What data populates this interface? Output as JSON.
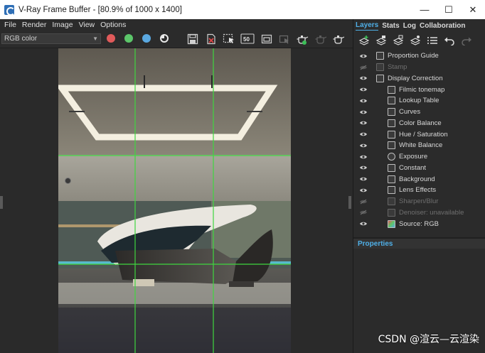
{
  "window": {
    "title": "V-Ray Frame Buffer - [80.9% of 1000 x 1400]",
    "controls": [
      "—",
      "☐",
      "✕"
    ]
  },
  "menu": [
    "File",
    "Render",
    "Image",
    "View",
    "Options"
  ],
  "toolbar": {
    "channel": "RGB color",
    "channel_dots": [
      {
        "name": "red-channel-toggle",
        "color": "#e05a5a"
      },
      {
        "name": "green-channel-toggle",
        "color": "#5cc66a"
      },
      {
        "name": "blue-channel-toggle",
        "color": "#5aa8e0"
      },
      {
        "name": "alpha-channel-toggle",
        "color": "#dddddd"
      }
    ],
    "icons": [
      "save-image-icon",
      "clear-image-icon",
      "region-render-icon",
      "history-50-icon",
      "compare-icon",
      "cursor-track-icon",
      "render-teapot-icon",
      "stop-render-icon",
      "interactive-render-icon"
    ],
    "history_label": "50"
  },
  "panel": {
    "tabs": [
      "Layers",
      "Stats",
      "Log",
      "Collaboration"
    ],
    "active_tab": "Layers",
    "layer_tools": [
      "add-layer-icon",
      "save-layers-icon",
      "load-layers-icon",
      "layer-presets-icon",
      "list-icon",
      "undo-icon",
      "redo-icon"
    ],
    "layers": [
      {
        "label": "Proportion Guide",
        "indent": 0,
        "enabled": true,
        "icon": "proportion-guide-icon"
      },
      {
        "label": "Stamp",
        "indent": 0,
        "enabled": false,
        "icon": "stamp-icon"
      },
      {
        "label": "Display Correction",
        "indent": 0,
        "enabled": true,
        "icon": "display-correction-icon"
      },
      {
        "label": "Filmic tonemap",
        "indent": 1,
        "enabled": true,
        "icon": "filmic-tonemap-icon"
      },
      {
        "label": "Lookup Table",
        "indent": 1,
        "enabled": true,
        "icon": "lut-icon"
      },
      {
        "label": "Curves",
        "indent": 1,
        "enabled": true,
        "icon": "curves-icon"
      },
      {
        "label": "Color Balance",
        "indent": 1,
        "enabled": true,
        "icon": "color-balance-icon"
      },
      {
        "label": "Hue / Saturation",
        "indent": 1,
        "enabled": true,
        "icon": "hue-saturation-icon"
      },
      {
        "label": "White Balance",
        "indent": 1,
        "enabled": true,
        "icon": "white-balance-icon"
      },
      {
        "label": "Exposure",
        "indent": 1,
        "enabled": true,
        "icon": "exposure-icon"
      },
      {
        "label": "Constant",
        "indent": 1,
        "enabled": true,
        "icon": "constant-icon"
      },
      {
        "label": "Background",
        "indent": 1,
        "enabled": true,
        "icon": "background-icon"
      },
      {
        "label": "Lens Effects",
        "indent": 1,
        "enabled": true,
        "icon": "lens-effects-icon"
      },
      {
        "label": "Sharpen/Blur",
        "indent": 1,
        "enabled": false,
        "icon": "sharpen-blur-icon"
      },
      {
        "label": "Denoiser: unavailable",
        "indent": 1,
        "enabled": false,
        "icon": "denoiser-icon"
      },
      {
        "label": "Source: RGB",
        "indent": 1,
        "enabled": true,
        "icon": "source-rgb-icon"
      }
    ],
    "properties_label": "Properties"
  },
  "colors": {
    "accent": "#4fb0e8",
    "background": "#2b2b2b",
    "guide_lines": "#3fd63f"
  },
  "watermark": "CSDN @渲云—云渲染"
}
